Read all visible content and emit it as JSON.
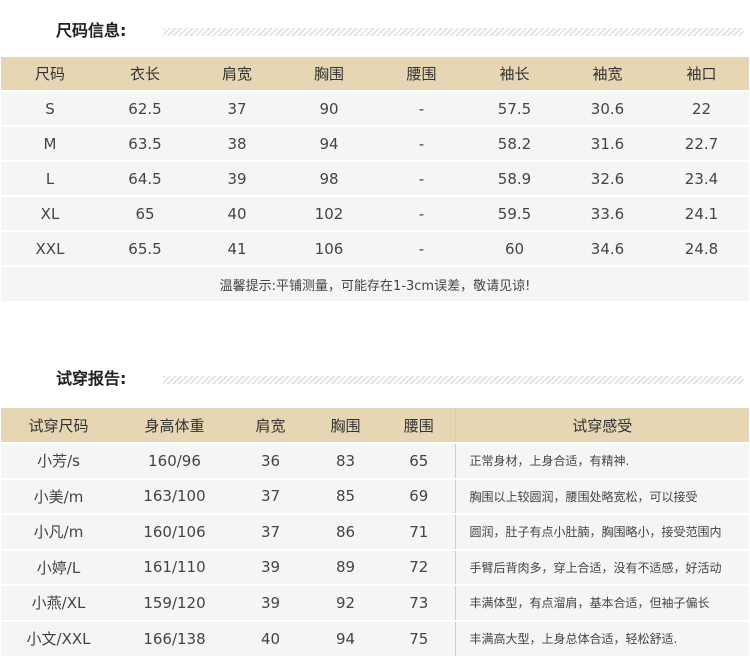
{
  "size_section": {
    "title": "尺码信息:",
    "headers": [
      "尺码",
      "衣长",
      "肩宽",
      "胸围",
      "腰围",
      "袖长",
      "袖宽",
      "袖口"
    ],
    "rows": [
      [
        "S",
        "62.5",
        "37",
        "90",
        "-",
        "57.5",
        "30.6",
        "22"
      ],
      [
        "M",
        "63.5",
        "38",
        "94",
        "-",
        "58.2",
        "31.6",
        "22.7"
      ],
      [
        "L",
        "64.5",
        "39",
        "98",
        "-",
        "58.9",
        "32.6",
        "23.4"
      ],
      [
        "XL",
        "65",
        "40",
        "102",
        "-",
        "59.5",
        "33.6",
        "24.1"
      ],
      [
        "XXL",
        "65.5",
        "41",
        "106",
        "-",
        "60",
        "34.6",
        "24.8"
      ]
    ],
    "note": "温馨提示:平铺测量，可能存在1-3cm误差，敬请见谅!"
  },
  "trial_section": {
    "title": "试穿报告:",
    "headers": [
      "试穿尺码",
      "身高体重",
      "肩宽",
      "胸围",
      "腰围",
      "试穿感受"
    ],
    "rows": [
      [
        "小芳/s",
        "160/96",
        "36",
        "83",
        "65",
        "正常身材，上身合适，有精神."
      ],
      [
        "小美/m",
        "163/100",
        "37",
        "85",
        "69",
        "胸围以上较圆润，腰围处略宽松，可以接受"
      ],
      [
        "小凡/m",
        "160/106",
        "37",
        "86",
        "71",
        "圆润，肚子有点小肚腩，胸围略小，接受范围内"
      ],
      [
        "小婷/L",
        "161/110",
        "39",
        "89",
        "72",
        "手臂后背肉多，穿上合适，没有不适感，好活动"
      ],
      [
        "小燕/XL",
        "159/120",
        "39",
        "92",
        "73",
        "丰满体型，有点溜肩，基本合适，但袖子偏长"
      ],
      [
        "小文/XXL",
        "166/138",
        "40",
        "94",
        "75",
        "丰满高大型，上身总体合适，轻松舒适."
      ]
    ]
  }
}
